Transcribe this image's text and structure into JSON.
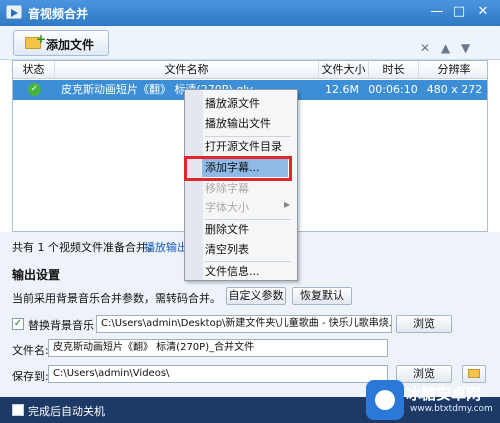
{
  "window": {
    "title": "音视频合并"
  },
  "toolbar": {
    "add_file_label": "添加文件"
  },
  "table": {
    "columns": [
      "状态",
      "文件名称",
      "文件大小",
      "时长",
      "分辨率"
    ],
    "rows": [
      {
        "status": "ok",
        "name": "皮克斯动画短片《翻》 标清(270P).qlv",
        "size": "12.6M",
        "duration": "00:06:10",
        "resolution": "480 x 272"
      }
    ]
  },
  "context_menu": {
    "items": [
      {
        "label": "播放源文件",
        "enabled": true
      },
      {
        "label": "播放输出文件",
        "enabled": true
      },
      {
        "label": "打开源文件目录",
        "enabled": true
      },
      {
        "label": "添加字幕...",
        "enabled": true,
        "highlighted": true
      },
      {
        "label": "移除字幕",
        "enabled": false
      },
      {
        "label": "字体大小",
        "enabled": false,
        "submenu": true
      },
      {
        "label": "删除文件",
        "enabled": true
      },
      {
        "label": "清空列表",
        "enabled": true
      },
      {
        "label": "文件信息...",
        "enabled": true
      }
    ]
  },
  "summary": {
    "text": "共有 1 个视频文件准备合并。",
    "play_output_link": "播放输出"
  },
  "output": {
    "section_title": "输出设置",
    "bgm_note": "当前采用背景音乐合并参数，需转码合并。",
    "custom_params_button": "自定义参数",
    "restore_default_button": "恢复默认",
    "replace_bgm_label": "替换背景音乐",
    "replace_bgm_checked": true,
    "bgm_path": "C:\\Users\\admin\\Desktop\\新建文件夹\\儿童歌曲 - 快乐儿歌串烧.m",
    "browse_button": "浏览",
    "filename_label": "文件名:",
    "filename_value": "皮克斯动画短片《翻》 标清(270P)_合并文件",
    "save_to_label": "保存到:",
    "save_to_value": "C:\\Users\\admin\\Videos\\",
    "save_browse_button": "浏览"
  },
  "footer": {
    "auto_shutdown_label": "完成后自动关机",
    "auto_shutdown_checked": false
  },
  "watermark": {
    "title": "冰糖安卓网",
    "url": "www.btxtdmy.com"
  },
  "colors": {
    "titlebar": "#3a86d3",
    "selected_row": "#3c8fd6",
    "highlight_box": "#e3262c",
    "status_ok": "#49b43b"
  }
}
